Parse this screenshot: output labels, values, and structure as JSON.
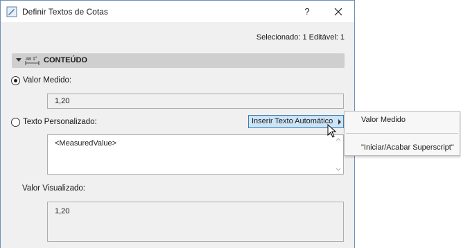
{
  "window": {
    "title": "Definir Textos de Cotas",
    "help_label": "?"
  },
  "selection_info": "Selecionado: 1 Editável: 1",
  "section": {
    "title": "CONTEÚDO",
    "icon": "dimension-text-icon"
  },
  "measured": {
    "label": "Valor Medido:",
    "value": "1,20",
    "checked": true
  },
  "custom": {
    "label": "Texto Personalizado:",
    "checked": false,
    "insert_button": "Inserir Texto Automático",
    "text": "<MeasuredValue>"
  },
  "display": {
    "label": "Valor Visualizado:",
    "value": "1,20"
  },
  "popup_menu": {
    "items": [
      "Valor Medido",
      "\"Iniciar/Acabar Superscript\""
    ]
  },
  "colors": {
    "accent_button": "#cce4f7",
    "window_border": "#6e8fb8"
  }
}
